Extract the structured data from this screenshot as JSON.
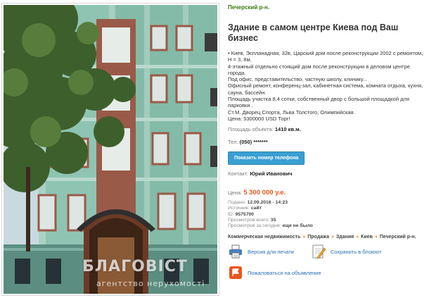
{
  "photo": {
    "alt": "Здание",
    "watermark": "БЛАГОВІСТ",
    "watermark_sub": "агентство нерухомості"
  },
  "listing": {
    "district": "Печерский р-н.",
    "title": "Здание в самом центре Киева под Ваш бизнес",
    "description": [
      "• Киев, Эспланадная, 32в, Царский дом после реконструкции 2002 с ремонтом, Н = 3, 8м.",
      "4-этажный отдельно стоящий дом после реконструкции в деловом центре города.",
      "Под офис, представительство, частную школу, клинику...",
      "Офисный ремонт, конференц-зал, кабинетная система, комната отдыха, кухня, сауна, бассейн.",
      "Площадь участка 8.4 сотки, собственный двор с большой площадкой для парковки .",
      "Ст.М. Дворец Спорта, Льва Толстого, Олимпийская.",
      "Цена: 5300000 USD Торг!"
    ],
    "area_label": "Площадь объекта:",
    "area_value": "1410 кв.м.",
    "phone_label": "Тел:",
    "phone_value": "(050) *******",
    "show_phone_button": "Показать номер телефона",
    "contact_label": "Контакт:",
    "contact_value": "Юрий Иванович",
    "price_label": "Цена:",
    "price_value": "5 300 000 у.е.",
    "meta": {
      "posted_label": "Подано:",
      "posted_value": "12.09.2016 - 14:23",
      "source_label": "Источник:",
      "source_value": "сайт",
      "id_label": "ID:",
      "id_value": "9575700",
      "views_label": "Просмотров всего:",
      "views_value": "35",
      "views_today_label": "Просмотров за сегодня:",
      "views_today_value": "еще не было"
    },
    "breadcrumbs": [
      "Коммерческая недвижимость",
      "Продажа",
      "Здания",
      "Киев",
      "Печерский р-н."
    ],
    "breadcrumb_separator": "»",
    "print_label": "Версия для печати",
    "save_label": "Сохранить в блокнот",
    "report_label": "Пожаловаться на объявление"
  },
  "colors": {
    "district": "#3a7a10",
    "price": "#e8561b",
    "button": "#3a9fd2",
    "link": "#2a6fb8"
  },
  "icons": {
    "print": "printer-icon",
    "save": "notepad-icon",
    "report": "report-icon"
  }
}
